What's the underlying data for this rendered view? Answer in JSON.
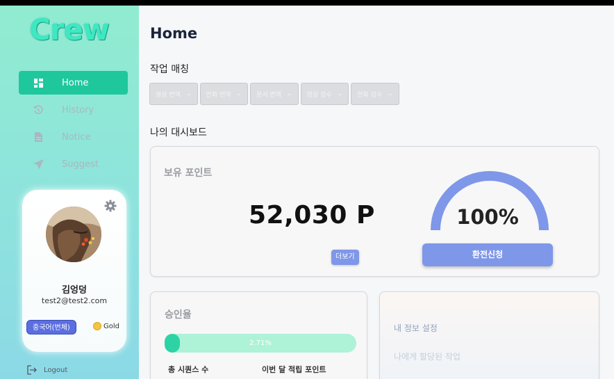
{
  "app": {
    "logo": "Crew"
  },
  "sidebar": {
    "items": [
      {
        "label": "Home",
        "icon": "dashboard-icon",
        "active": true
      },
      {
        "label": "History",
        "icon": "history-icon",
        "active": false
      },
      {
        "label": "Notice",
        "icon": "document-icon",
        "active": false
      },
      {
        "label": "Suggest",
        "icon": "send-icon",
        "active": false
      }
    ],
    "logout_label": "Logout"
  },
  "profile": {
    "name": "김엉덩",
    "email": "test2@test2.com",
    "language_badge": "중국어(번체)",
    "tier": "Gold"
  },
  "main": {
    "title": "Home",
    "matching_title": "작업 매칭",
    "chips": [
      "영상 번역",
      "만화 번역",
      "문서 번역",
      "영상 검수",
      "만화 검수"
    ],
    "dashboard_title": "나의 대시보드",
    "points": {
      "label": "보유 포인트",
      "value": "52,030 P",
      "more_label": "더보기",
      "gauge_text": "100%",
      "gauge_fraction": 1.0,
      "exchange_label": "환전신청"
    },
    "approval": {
      "label": "승인율",
      "bar_text": "2.71%",
      "bar_fraction": 0.0271,
      "stat_sequences_label": "총 시퀀스 수",
      "stat_monthly_points_label": "이번 달 적립 포인트"
    },
    "info": {
      "my_settings_label": "내 정보 설정",
      "assigned_tasks_label": "나에게 할당된 작업"
    }
  },
  "colors": {
    "accent": "#1fc79d",
    "button_blue": "#7f97e8",
    "badge_blue": "#5b6ee0",
    "progress_fill": "#2ed3a5",
    "progress_track": "#aef2d8",
    "gauge": "#7f97e8"
  }
}
